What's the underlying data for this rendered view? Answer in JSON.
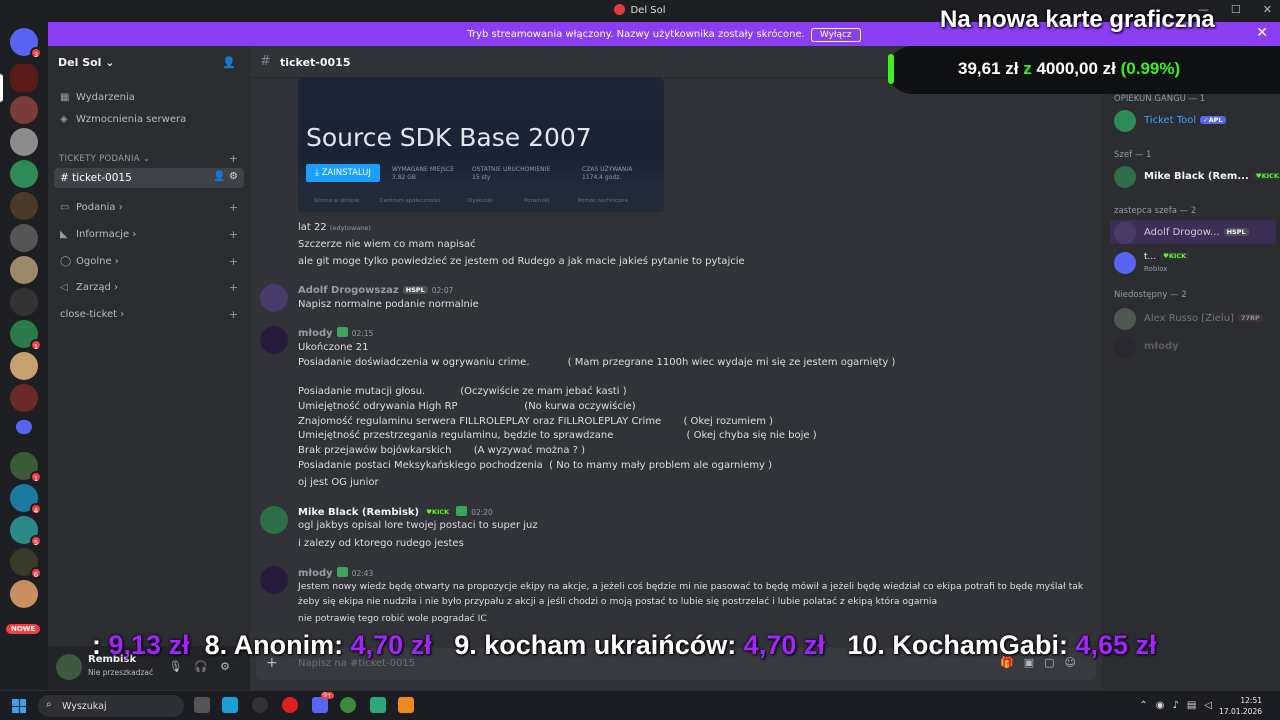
{
  "window": {
    "title": "Del Sol"
  },
  "banner": {
    "text": "Tryb streamowania włączony. Nazwy użytkownika zostały skrócone.",
    "button": "Wyłącz"
  },
  "rail": {
    "badges": [
      "3",
      "1",
      "1",
      "4",
      "5",
      "6"
    ],
    "new_label": "NOWE"
  },
  "sidebar": {
    "server_name": "Del Sol",
    "events": "Wydarzenia",
    "boosts": "Wzmocnienia serwera",
    "category": "TICKETY PODANIA",
    "active_channel": "ticket-0015",
    "categories": [
      "Podania",
      "Informacje",
      "Ogolne",
      "Zarząd",
      "close-ticket"
    ]
  },
  "user": {
    "name": "Rembisk",
    "status": "Nie przeszkadzać"
  },
  "channel": {
    "name": "ticket-0015",
    "placeholder": "Napisz na #ticket-0015"
  },
  "steam_card": {
    "title": "Source SDK Base 2007",
    "install": "ZAINSTALUJ",
    "stats": [
      {
        "label": "WYMAGANE MIEJSCE",
        "value": "3,82 GB"
      },
      {
        "label": "OSTATNIE URUCHOMIENIE",
        "value": "15 sty"
      },
      {
        "label": "CZAS UŻYWANIA",
        "value": "1174,4 godz."
      }
    ],
    "nav": [
      "Strona w sklepie",
      "Centrum społeczności",
      "Dyskusje",
      "Poradniki",
      "Pomoc techniczna"
    ]
  },
  "messages": [
    {
      "lines": [
        "lat 22",
        "Szczerze nie wiem co mam napisać",
        "ale git moge tylko powiedzieć ze jestem od Rudego a jak macie jakieś pytanie to pytajcie"
      ],
      "edited": "(edytowane)"
    },
    {
      "author": "Adolf Drogowszaz",
      "tag": "HSPL",
      "time": "02:07",
      "lines": [
        "Napisz normalne podanie normalnie"
      ]
    },
    {
      "author": "młody",
      "time": "02:15",
      "lines": [
        "Ukończone 21",
        "Posiadanie doświadczenia w ogrywaniu crime.            ( Mam przegrane 1100h wiec wydaje mi się ze jestem ogarnięty )",
        "",
        "Posiadanie mutacji głosu.           (Oczywiście ze mam jebać kasti )",
        "Umiejętność odrywania High RP                     (No kurwa oczywiście)",
        "Znajomość regulaminu serwera FILLROLEPLAY oraz FILLROLEPLAY Crime       ( Okej rozumiem )",
        "Umiejętność przestrzegania regulaminu, będzie to sprawdzane                       ( Okej chyba się nie boje )",
        "Brak przejawów bojówkarskich       (A wyzywać można ? )",
        "Posiadanie postaci Meksykańskiego pochodzenia  ( No to mamy mały problem ale ogarniemy )",
        "oj jest OG junior"
      ]
    },
    {
      "author": "Mike Black (Rembisk)",
      "tag": "KICK",
      "time": "02:20",
      "lines": [
        "ogl jakbys opisal lore twojej postaci to super juz",
        "i zalezy od ktorego rudego jestes"
      ]
    },
    {
      "author": "młody",
      "time": "02:43",
      "lines": [
        "Jestem nowy wiedz będę otwarty na propozycje ekipy na akcje, a jeżeli coś będzie mi nie pasować to będę mówił a jeżeli będę wiedział co ekipa potrafi to będę myślał tak",
        "żeby się ekipa nie nudziła i nie było przypału z akcji a jeśli chodzi o moją postać to lubie się postrzelać i lubie polatać z ekipą która ogarnia",
        "nie potrawię tego robić wole pogradać IC"
      ]
    }
  ],
  "members": {
    "groups": [
      "OPIEKUN GANGU — 1",
      "Szef — 1",
      "zastepca szefa — 2",
      "Niedostępny — 2"
    ],
    "list": [
      {
        "name": "Ticket Tool",
        "tag": "APL"
      },
      {
        "name": "Mike Black (Rem...",
        "tag": "KICK"
      },
      {
        "name": "Adolf Drogow...",
        "tag": "HSPL"
      },
      {
        "name": "t...",
        "tag": "KICK",
        "sub": "Roblox"
      },
      {
        "name": "Alex Russo [Zielu]",
        "tag": "77RP"
      },
      {
        "name": "młody"
      }
    ]
  },
  "overlay": {
    "title": "Na nowa karte graficzna",
    "amount": "39,61 zł",
    "sep": "z",
    "goal": "4000,00 zł",
    "pct": "(0.99%)",
    "ticker": [
      {
        "label": ":",
        "price": "9,13 zł"
      },
      {
        "label": "8. Anonim:",
        "price": "4,70 zł"
      },
      {
        "label": "9. kocham ukraińców:",
        "price": "4,70 zł"
      },
      {
        "label": "10. KochamGabi:",
        "price": "4,65 zł"
      }
    ]
  },
  "taskbar": {
    "search": "Wyszukaj",
    "time": "12:51",
    "date": "17.01.2026",
    "discord_badge": "9+"
  },
  "colors": {
    "accent": "#8a3df3",
    "overlay_purple": "#a225ff",
    "overlay_green": "#3ef022"
  }
}
